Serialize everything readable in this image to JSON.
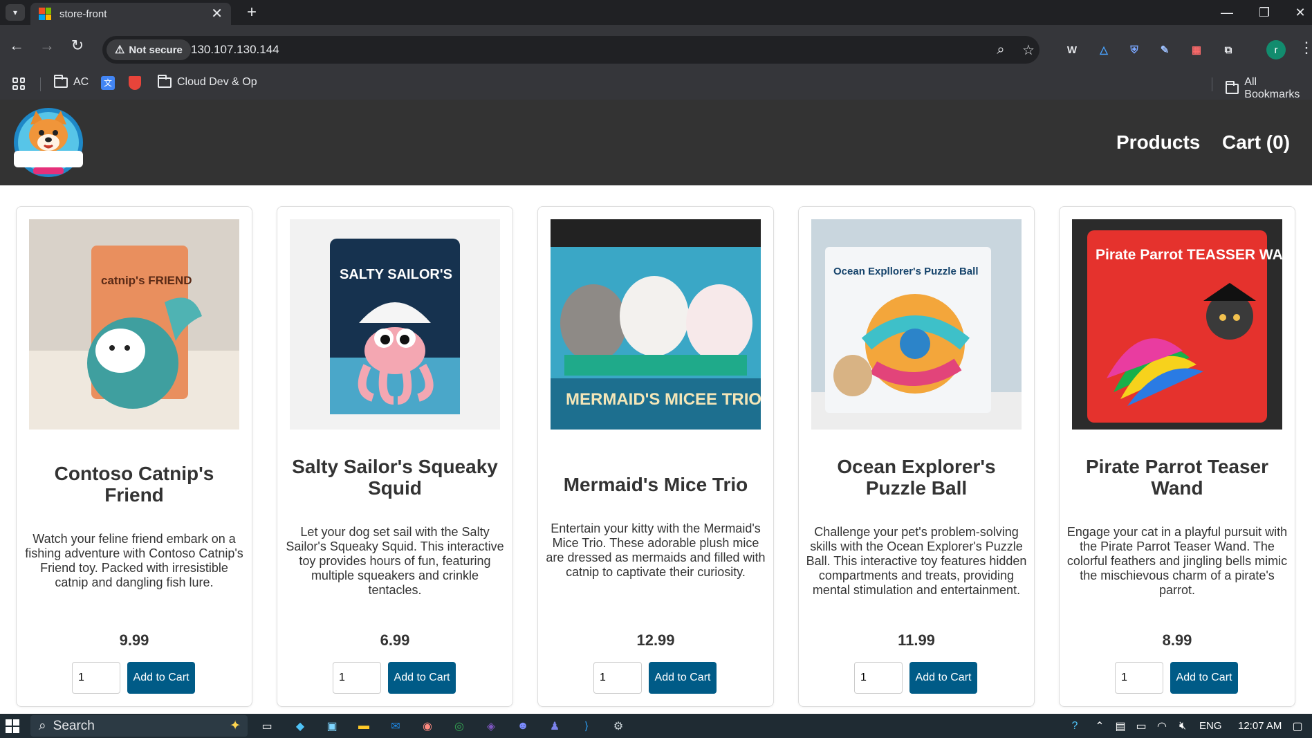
{
  "browser": {
    "tab_title": "store-front",
    "tab_close": "✕",
    "new_tab": "+",
    "security_label": "Not secure",
    "url": "130.107.130.144",
    "profile_initial": "r",
    "bookmarks": [
      {
        "label": "AC"
      },
      {
        "label": "Cloud Dev & Op"
      }
    ],
    "all_bookmarks": "All Bookmarks"
  },
  "site": {
    "nav": {
      "products": "Products",
      "cart": "Cart (0)"
    }
  },
  "products": [
    {
      "name": "Contoso Catnip's Friend",
      "description": "Watch your feline friend embark on a fishing adventure with Contoso Catnip's Friend toy. Packed with irresistible catnip and dangling fish lure.",
      "price": "9.99",
      "qty": "1",
      "button": "Add to Cart",
      "image_text": "catnip's FRIEND"
    },
    {
      "name": "Salty Sailor's Squeaky Squid",
      "description": "Let your dog set sail with the Salty Sailor's Squeaky Squid. This interactive toy provides hours of fun, featuring multiple squeakers and crinkle tentacles.",
      "price": "6.99",
      "qty": "1",
      "button": "Add to Cart",
      "image_text": "SALTY SAILOR'S"
    },
    {
      "name": "Mermaid's Mice Trio",
      "description": "Entertain your kitty with the Mermaid's Mice Trio. These adorable plush mice are dressed as mermaids and filled with catnip to captivate their curiosity.",
      "price": "12.99",
      "qty": "1",
      "button": "Add to Cart",
      "image_text": "MERMAID'S MICEE TRIO"
    },
    {
      "name": "Ocean Explorer's Puzzle Ball",
      "description": "Challenge your pet's problem-solving skills with the Ocean Explorer's Puzzle Ball. This interactive toy features hidden compartments and treats, providing mental stimulation and entertainment.",
      "price": "11.99",
      "qty": "1",
      "button": "Add to Cart",
      "image_text": "Ocean Expllorer's Puzzle Ball"
    },
    {
      "name": "Pirate Parrot Teaser Wand",
      "description": "Engage your cat in a playful pursuit with the Pirate Parrot Teaser Wand. The colorful feathers and jingling bells mimic the mischievous charm of a pirate's parrot.",
      "price": "8.99",
      "qty": "1",
      "button": "Add to Cart",
      "image_text": "Pirate Parrot TEASSER WAND"
    }
  ],
  "taskbar": {
    "search_label": "Search",
    "lang": "ENG",
    "time": "12:07 AM"
  },
  "colors": {
    "header_bg": "#333333",
    "button_bg": "#005b87",
    "browser_bg": "#35363a"
  }
}
